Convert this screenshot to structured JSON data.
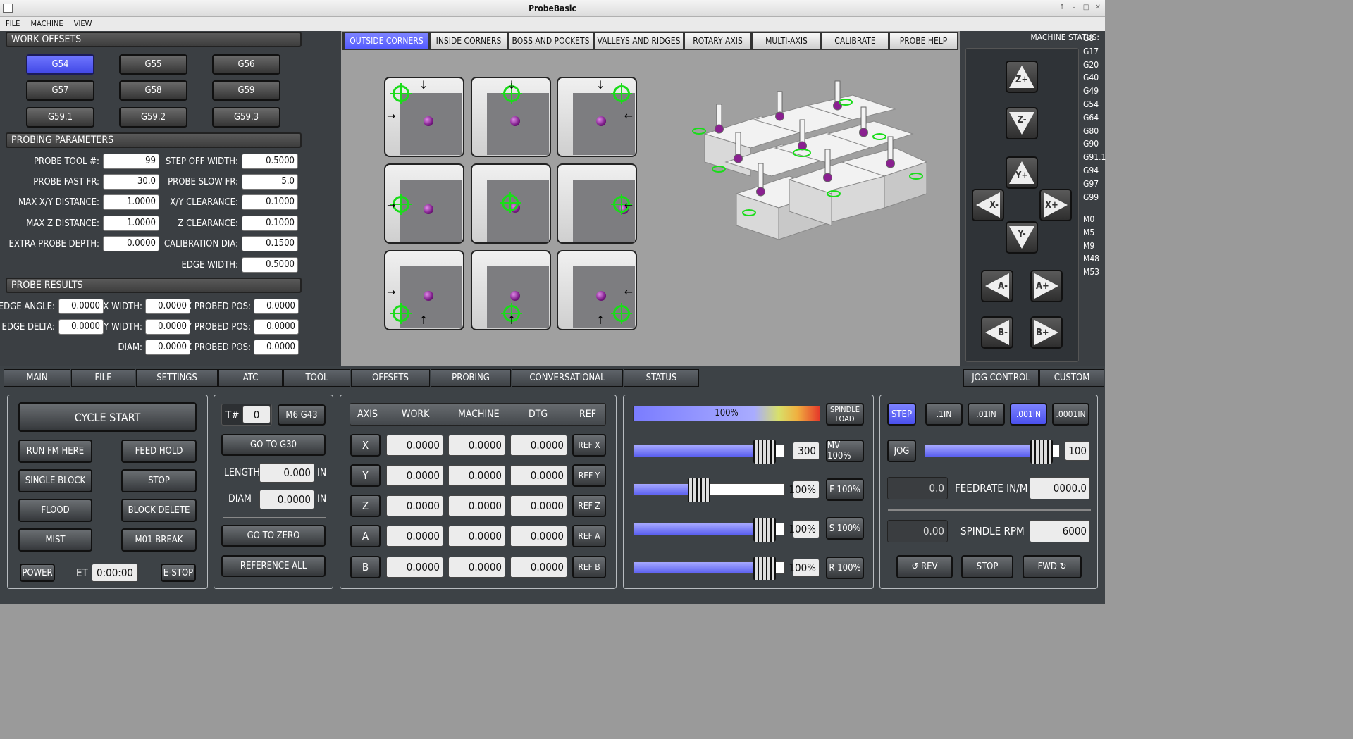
{
  "window": {
    "title": "ProbeBasic"
  },
  "menu": [
    "FILE",
    "MACHINE",
    "VIEW"
  ],
  "work_offsets": {
    "title": "WORK OFFSETS",
    "buttons": [
      "G54",
      "G55",
      "G56",
      "G57",
      "G58",
      "G59",
      "G59.1",
      "G59.2",
      "G59.3"
    ],
    "active": "G54"
  },
  "probing_params": {
    "title": "PROBING PARAMETERS",
    "left": [
      {
        "label": "PROBE TOOL #:",
        "value": "99"
      },
      {
        "label": "PROBE FAST FR:",
        "value": "30.0"
      },
      {
        "label": "MAX X/Y DISTANCE:",
        "value": "1.0000"
      },
      {
        "label": "MAX Z DISTANCE:",
        "value": "1.0000"
      },
      {
        "label": "EXTRA PROBE DEPTH:",
        "value": "0.0000"
      }
    ],
    "right": [
      {
        "label": "STEP OFF WIDTH:",
        "value": "0.5000"
      },
      {
        "label": "PROBE SLOW FR:",
        "value": "5.0"
      },
      {
        "label": "X/Y CLEARANCE:",
        "value": "0.1000"
      },
      {
        "label": "Z CLEARANCE:",
        "value": "0.1000"
      },
      {
        "label": "CALIBRATION DIA:",
        "value": "0.1500"
      },
      {
        "label": "EDGE WIDTH:",
        "value": "0.5000"
      }
    ]
  },
  "probe_results": {
    "title": "PROBE RESULTS",
    "col1": [
      {
        "label": "EDGE ANGLE:",
        "value": "0.0000"
      },
      {
        "label": "EDGE DELTA:",
        "value": "0.0000"
      }
    ],
    "col2": [
      {
        "label": "X WIDTH:",
        "value": "0.0000"
      },
      {
        "label": "Y WIDTH:",
        "value": "0.0000"
      },
      {
        "label": "DIAM:",
        "value": "0.0000"
      }
    ],
    "col3": [
      {
        "label": "X PROBED POS:",
        "value": "0.0000"
      },
      {
        "label": "Y PROBED POS:",
        "value": "0.0000"
      },
      {
        "label": "Z PROBED POS:",
        "value": "0.0000"
      }
    ]
  },
  "probe_tabs": [
    "OUTSIDE CORNERS",
    "INSIDE CORNERS",
    "BOSS AND POCKETS",
    "VALLEYS AND RIDGES",
    "ROTARY AXIS",
    "MULTI-AXIS",
    "CALIBRATE",
    "PROBE HELP"
  ],
  "probe_tab_active": "OUTSIDE CORNERS",
  "machine_status": {
    "title": "MACHINE STATUS:",
    "gcodes": [
      "G8",
      "G17",
      "G20",
      "G40",
      "G49",
      "G54",
      "G64",
      "G80",
      "G90",
      "G91.1",
      "G94",
      "G97",
      "G99"
    ],
    "mcodes": [
      "M0",
      "M5",
      "M9",
      "M48",
      "M53"
    ]
  },
  "jog_buttons": {
    "zp": "Z+",
    "zm": "Z-",
    "yp": "Y+",
    "ym": "Y-",
    "xm": "X-",
    "xp": "X+",
    "am": "A-",
    "ap": "A+",
    "bm": "B-",
    "bp": "B+"
  },
  "main_tabs": [
    "MAIN",
    "FILE",
    "SETTINGS",
    "ATC",
    "TOOL",
    "OFFSETS",
    "PROBING",
    "CONVERSATIONAL",
    "STATUS"
  ],
  "main_tab_active": "PROBING",
  "right_tabs": [
    "JOG CONTROL",
    "CUSTOM"
  ],
  "right_tab_active": "JOG CONTROL",
  "program": {
    "cycle_start": "CYCLE START",
    "run_from_here": "RUN FM HERE",
    "feed_hold": "FEED HOLD",
    "single_block": "SINGLE BLOCK",
    "stop": "STOP",
    "flood": "FLOOD",
    "block_delete": "BLOCK DELETE",
    "mist": "MIST",
    "m01_break": "M01 BREAK",
    "power": "POWER",
    "et_label": "ET",
    "et_value": "0:00:00",
    "estop": "E-STOP"
  },
  "tool": {
    "t_label": "T#",
    "t_value": "0",
    "m6": "M6 G43",
    "goto_g30": "GO TO G30",
    "length_label": "LENGTH",
    "length_value": "0.000",
    "diam_label": "DIAM",
    "diam_value": "0.0000",
    "unit": "IN",
    "goto_zero": "GO TO ZERO",
    "ref_all": "REFERENCE ALL"
  },
  "dro": {
    "headers": [
      "AXIS",
      "WORK",
      "MACHINE",
      "DTG",
      "REF"
    ],
    "rows": [
      {
        "axis": "X",
        "work": "0.0000",
        "machine": "0.0000",
        "dtg": "0.0000",
        "ref": "REF X"
      },
      {
        "axis": "Y",
        "work": "0.0000",
        "machine": "0.0000",
        "dtg": "0.0000",
        "ref": "REF Y"
      },
      {
        "axis": "Z",
        "work": "0.0000",
        "machine": "0.0000",
        "dtg": "0.0000",
        "ref": "REF Z"
      },
      {
        "axis": "A",
        "work": "0.0000",
        "machine": "0.0000",
        "dtg": "0.0000",
        "ref": "REF A"
      },
      {
        "axis": "B",
        "work": "0.0000",
        "machine": "0.0000",
        "dtg": "0.0000",
        "ref": "REF B"
      }
    ]
  },
  "overrides": {
    "spindle_load_pct": "100%",
    "spindle_load_label": "SPINDLE LOAD",
    "max_vel": "300",
    "mv_btn": "MV 100%",
    "feed": "100%",
    "f_btn": "F 100%",
    "spindle": "100%",
    "s_btn": "S 100%",
    "rapid": "100%",
    "r_btn": "R 100%",
    "max_vel_level": 0.86,
    "feed_level": 0.43,
    "spindle_level": 0.86,
    "rapid_level": 0.86
  },
  "jog": {
    "step": "STEP",
    "increments": [
      ".1IN",
      ".01IN",
      ".001IN",
      ".0001IN"
    ],
    "active_inc": ".001IN",
    "jog": "JOG",
    "jog_value": "100",
    "jog_level": 0.86,
    "feed_actual": "0.0",
    "feed_label": "FEEDRATE IN/M",
    "feed_set": "0000.0",
    "spindle_actual": "0.00",
    "spindle_label": "SPINDLE RPM",
    "spindle_set": "6000",
    "rev": "REV",
    "stop": "STOP",
    "fwd": "FWD"
  },
  "colors": {
    "accent": "#5a60ff",
    "dark_bg": "#3d4246",
    "panel_bg": "#9b9b9b",
    "target_green": "#1adc1a"
  }
}
